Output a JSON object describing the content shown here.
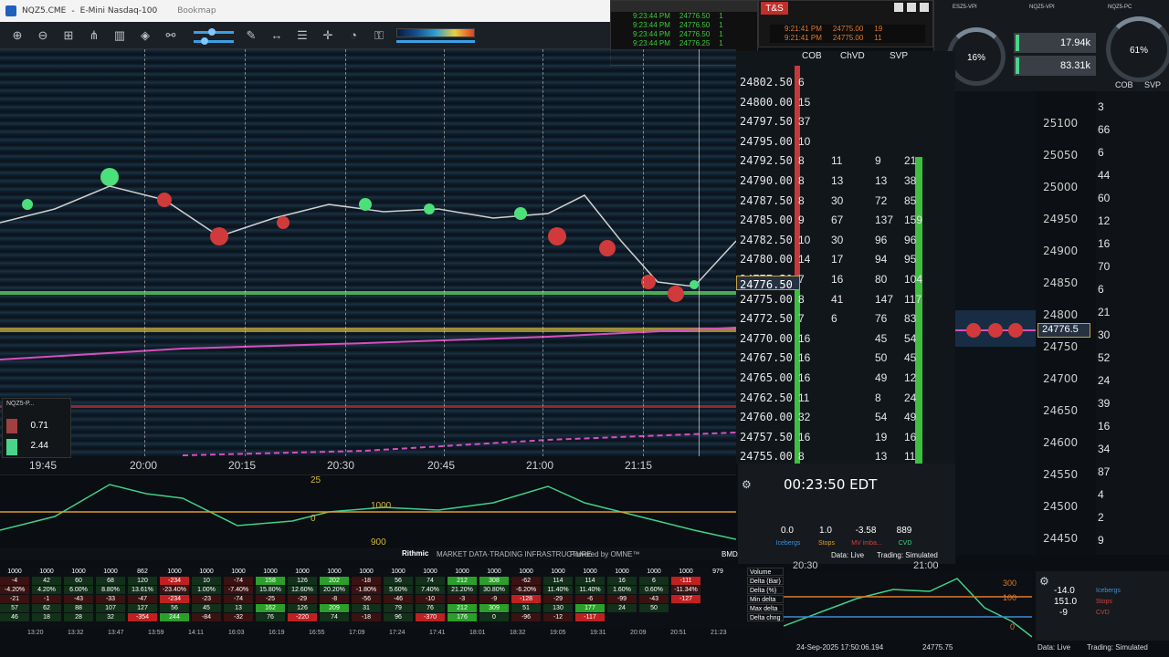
{
  "window": {
    "symbol": "NQZ5.CME",
    "description": "E-Mini Nasdaq-100",
    "app": "Bookmap"
  },
  "toolbar": {
    "icons": [
      "zoom-in-icon",
      "zoom-out-icon",
      "zoom-fit-icon",
      "share-icon",
      "chart-icon",
      "layers-icon",
      "link-icon"
    ],
    "tools2": [
      "pencil-icon",
      "measure-icon",
      "comment-icon",
      "crosshair-icon",
      "compass-icon",
      "lock-icon"
    ]
  },
  "time_sales_1": {
    "rows": [
      {
        "time": "9:23:44 PM",
        "price": "24776.50",
        "size": "1"
      },
      {
        "time": "9:23:44 PM",
        "price": "24776.50",
        "size": "1"
      },
      {
        "time": "9:23:44 PM",
        "price": "24776.50",
        "size": "1"
      },
      {
        "time": "9:23:44 PM",
        "price": "24776.25",
        "size": "1"
      }
    ]
  },
  "time_sales_2": {
    "tab": "T&S",
    "rows": [
      {
        "time": "9:21:41 PM",
        "price": "24775.00",
        "size": "19"
      },
      {
        "time": "9:21:41 PM",
        "price": "24775.00",
        "size": "11"
      }
    ]
  },
  "ladder": {
    "headers": {
      "cob": "COB",
      "chvd": "ChVD",
      "svp": "SVP"
    },
    "current": "24776.50",
    "rows": [
      {
        "price": "24802.50",
        "cob": "6",
        "chvd": "",
        "s1": "",
        "s2": ""
      },
      {
        "price": "24800.00",
        "cob": "15",
        "chvd": "",
        "s1": "",
        "s2": ""
      },
      {
        "price": "24797.50",
        "cob": "37",
        "chvd": "",
        "s1": "",
        "s2": ""
      },
      {
        "price": "24795.00",
        "cob": "10",
        "chvd": "",
        "s1": "",
        "s2": ""
      },
      {
        "price": "24792.50",
        "cob": "8",
        "chvd": "11",
        "s1": "9",
        "s2": "21"
      },
      {
        "price": "24790.00",
        "cob": "8",
        "chvd": "13",
        "s1": "13",
        "s2": "38"
      },
      {
        "price": "24787.50",
        "cob": "8",
        "chvd": "30",
        "s1": "72",
        "s2": "85"
      },
      {
        "price": "24785.00",
        "cob": "9",
        "chvd": "67",
        "s1": "137",
        "s2": "159"
      },
      {
        "price": "24782.50",
        "cob": "10",
        "chvd": "30",
        "s1": "96",
        "s2": "96"
      },
      {
        "price": "24780.00",
        "cob": "14",
        "chvd": "17",
        "s1": "94",
        "s2": "95"
      },
      {
        "price": "24777.50",
        "cob": "7",
        "chvd": "16",
        "s1": "80",
        "s2": "104"
      },
      {
        "price": "24775.00",
        "cob": "8",
        "chvd": "41",
        "s1": "147",
        "s2": "117"
      },
      {
        "price": "24772.50",
        "cob": "7",
        "chvd": "6",
        "s1": "76",
        "s2": "83"
      },
      {
        "price": "24770.00",
        "cob": "16",
        "chvd": "",
        "s1": "45",
        "s2": "54"
      },
      {
        "price": "24767.50",
        "cob": "16",
        "chvd": "",
        "s1": "50",
        "s2": "45"
      },
      {
        "price": "24765.00",
        "cob": "16",
        "chvd": "",
        "s1": "49",
        "s2": "12"
      },
      {
        "price": "24762.50",
        "cob": "11",
        "chvd": "",
        "s1": "8",
        "s2": "24"
      },
      {
        "price": "24760.00",
        "cob": "32",
        "chvd": "",
        "s1": "54",
        "s2": "49"
      },
      {
        "price": "24757.50",
        "cob": "16",
        "chvd": "",
        "s1": "19",
        "s2": "16"
      },
      {
        "price": "24755.00",
        "cob": "8",
        "chvd": "",
        "s1": "13",
        "s2": "11"
      }
    ]
  },
  "time_axis": [
    "19:45",
    "20:00",
    "20:15",
    "20:30",
    "20:45",
    "21:00",
    "21:15"
  ],
  "mini_panel": {
    "title": "NQZ5-P...",
    "v1": "0.71",
    "v2": "2.44"
  },
  "indicator": {
    "v1": "25",
    "v2": "1000",
    "v3": "0",
    "v4": "900"
  },
  "rithmic": {
    "brand": "Rithmic",
    "text": "MARKET DATA·TRADING INFRASTRUCTURE",
    "powered": "Powered by OMNE™",
    "bmd": "BMD/R+"
  },
  "status": {
    "clock": "00:23:50 EDT",
    "icebergs_val": "0.0",
    "stops_val": "1.0",
    "mv_val": "-3.58",
    "cvd_val": "889",
    "icebergs": "Icebergs",
    "stops": "Stops",
    "mv": "MV imba...",
    "cvd": "CVD",
    "data_live": "Data: Live",
    "trading": "Trading: Simulated"
  },
  "table": {
    "labels": [
      "Volume",
      "Delta (Bar)",
      "Delta (%)",
      "Min delta",
      "Max delta",
      "Delta chng"
    ],
    "rows": [
      [
        "1000",
        "1000",
        "1000",
        "1000",
        "862",
        "1000",
        "1000",
        "1000",
        "1000",
        "1000",
        "1000",
        "1000",
        "1000",
        "1000",
        "1000",
        "1000",
        "1000",
        "1000",
        "1000",
        "1000",
        "1000",
        "1000",
        "979"
      ],
      [
        "-4",
        "42",
        "60",
        "68",
        "120",
        "-234",
        "10",
        "-74",
        "158",
        "126",
        "202",
        "-18",
        "56",
        "74",
        "212",
        "308",
        "-62",
        "114",
        "114",
        "16",
        "6",
        "-111"
      ],
      [
        "-4.20%",
        "4.20%",
        "6.00%",
        "8.80%",
        "13.61%",
        "-23.40%",
        "1.00%",
        "-7.40%",
        "15.80%",
        "12.60%",
        "20.20%",
        "-1.80%",
        "5.60%",
        "7.40%",
        "21.20%",
        "30.80%",
        "-6.20%",
        "11.40%",
        "11.40%",
        "1.60%",
        "0.60%",
        "-11.34%"
      ],
      [
        "-21",
        "-1",
        "-43",
        "-33",
        "-47",
        "-234",
        "-23",
        "-74",
        "-25",
        "-29",
        "-8",
        "-56",
        "-46",
        "-10",
        "-3",
        "-9",
        "-128",
        "-29",
        "-6",
        "-99",
        "-43",
        "-127"
      ],
      [
        "57",
        "62",
        "88",
        "107",
        "127",
        "56",
        "45",
        "13",
        "162",
        "126",
        "209",
        "31",
        "79",
        "76",
        "212",
        "309",
        "51",
        "130",
        "177",
        "24",
        "50"
      ],
      [
        "46",
        "18",
        "28",
        "32",
        "-354",
        "244",
        "-84",
        "-32",
        "76",
        "-220",
        "74",
        "-18",
        "96",
        "-370",
        "176",
        "0",
        "-96",
        "-12",
        "-117"
      ]
    ]
  },
  "table_times": [
    "13:20",
    "13:32",
    "13:47",
    "13:59",
    "14:11",
    "16:03",
    "16:19",
    "16:55",
    "17:09",
    "17:24",
    "17:41",
    "18:01",
    "18:32",
    "19:05",
    "19:31",
    "20:09",
    "20:51",
    "21:23"
  ],
  "right_axis": [
    "25100",
    "25050",
    "25000",
    "24950",
    "24900",
    "24850",
    "24800",
    "24750",
    "24700",
    "24650",
    "24600",
    "24550",
    "24500",
    "24450"
  ],
  "right_cob": [
    "3",
    "66",
    "6",
    "44",
    "60",
    "12",
    "16",
    "70",
    "6",
    "21",
    "30",
    "52",
    "24",
    "39",
    "16",
    "34",
    "87",
    "4",
    "2",
    "9"
  ],
  "right_cur": "24776.5",
  "right_head": {
    "cob": "COB",
    "svp": "SVP"
  },
  "top_right": {
    "title1": "ESZ5-VPI",
    "title2": "NQZ5-VPI",
    "title3": "NQZ5-PC",
    "g1": "16%",
    "g2": "61%",
    "v1": "17.94k",
    "v2": "83.31k",
    "vpi": "VPI"
  },
  "bottom_right": {
    "v1": "-14.0",
    "v2": "151.0",
    "v3": "-9",
    "l1": "Icebergs",
    "l2": "Stops",
    "l3": "CVD",
    "data_live": "Data: Live",
    "trading": "Trading: Simulated",
    "t1": "20:30",
    "t2": "21:00",
    "n1": "300",
    "n2": "100",
    "n3": "0",
    "timestamp": "24-Sep-2025 17:50:06.194",
    "price": "24775.75"
  }
}
